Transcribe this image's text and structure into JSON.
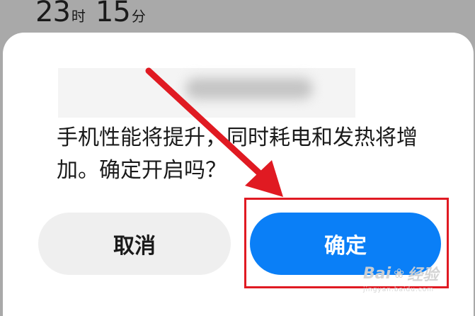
{
  "status_bar": {
    "hour": "23",
    "hour_unit": "时",
    "minute": "15",
    "minute_unit": "分"
  },
  "dialog": {
    "message": "手机性能将提升，同时耗电和发热将增加。确定开启吗？",
    "cancel_label": "取消",
    "confirm_label": "确定"
  },
  "colors": {
    "confirm_button": "#0a7ff7",
    "annotation_red": "#e01a22"
  },
  "watermark": {
    "brand": "Bai",
    "brand_suffix": "经验",
    "sub": "jingyan.baidu.com"
  }
}
